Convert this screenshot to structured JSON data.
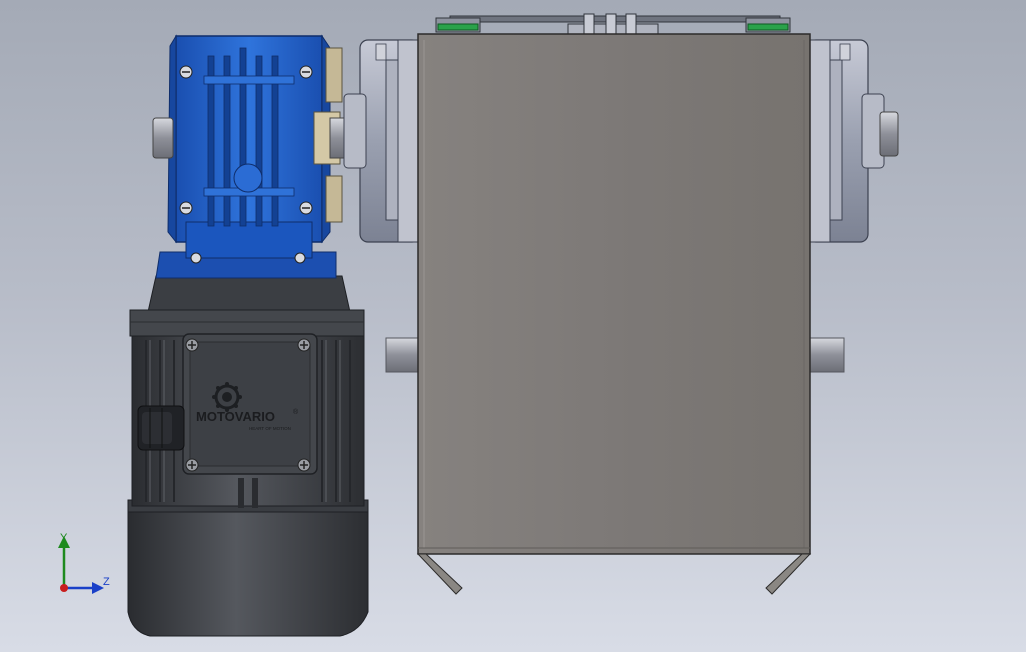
{
  "viewport": {
    "background_top": "#a4aab6",
    "background_bottom": "#d8dce6"
  },
  "model": {
    "motor_brand": "MOTOVARIO",
    "motor_brand_mark": "®",
    "motor_tagline": "HEART OF MOTION",
    "colors": {
      "gearbox_blue": "#1c5fc4",
      "motor_dark": "#3c3f44",
      "frame_gray": "#7f7b79",
      "bearing_gray": "#9ea3b2",
      "gasket_green": "#2aa24a"
    }
  },
  "triad": {
    "y_label": "Y",
    "z_label": "Z",
    "x_color": "#c81e1e",
    "y_color": "#1e8a1e",
    "z_color": "#1a40c8"
  },
  "icons": [
    "screw-icon",
    "motor-brand-logo-icon",
    "coordinate-triad-icon"
  ]
}
